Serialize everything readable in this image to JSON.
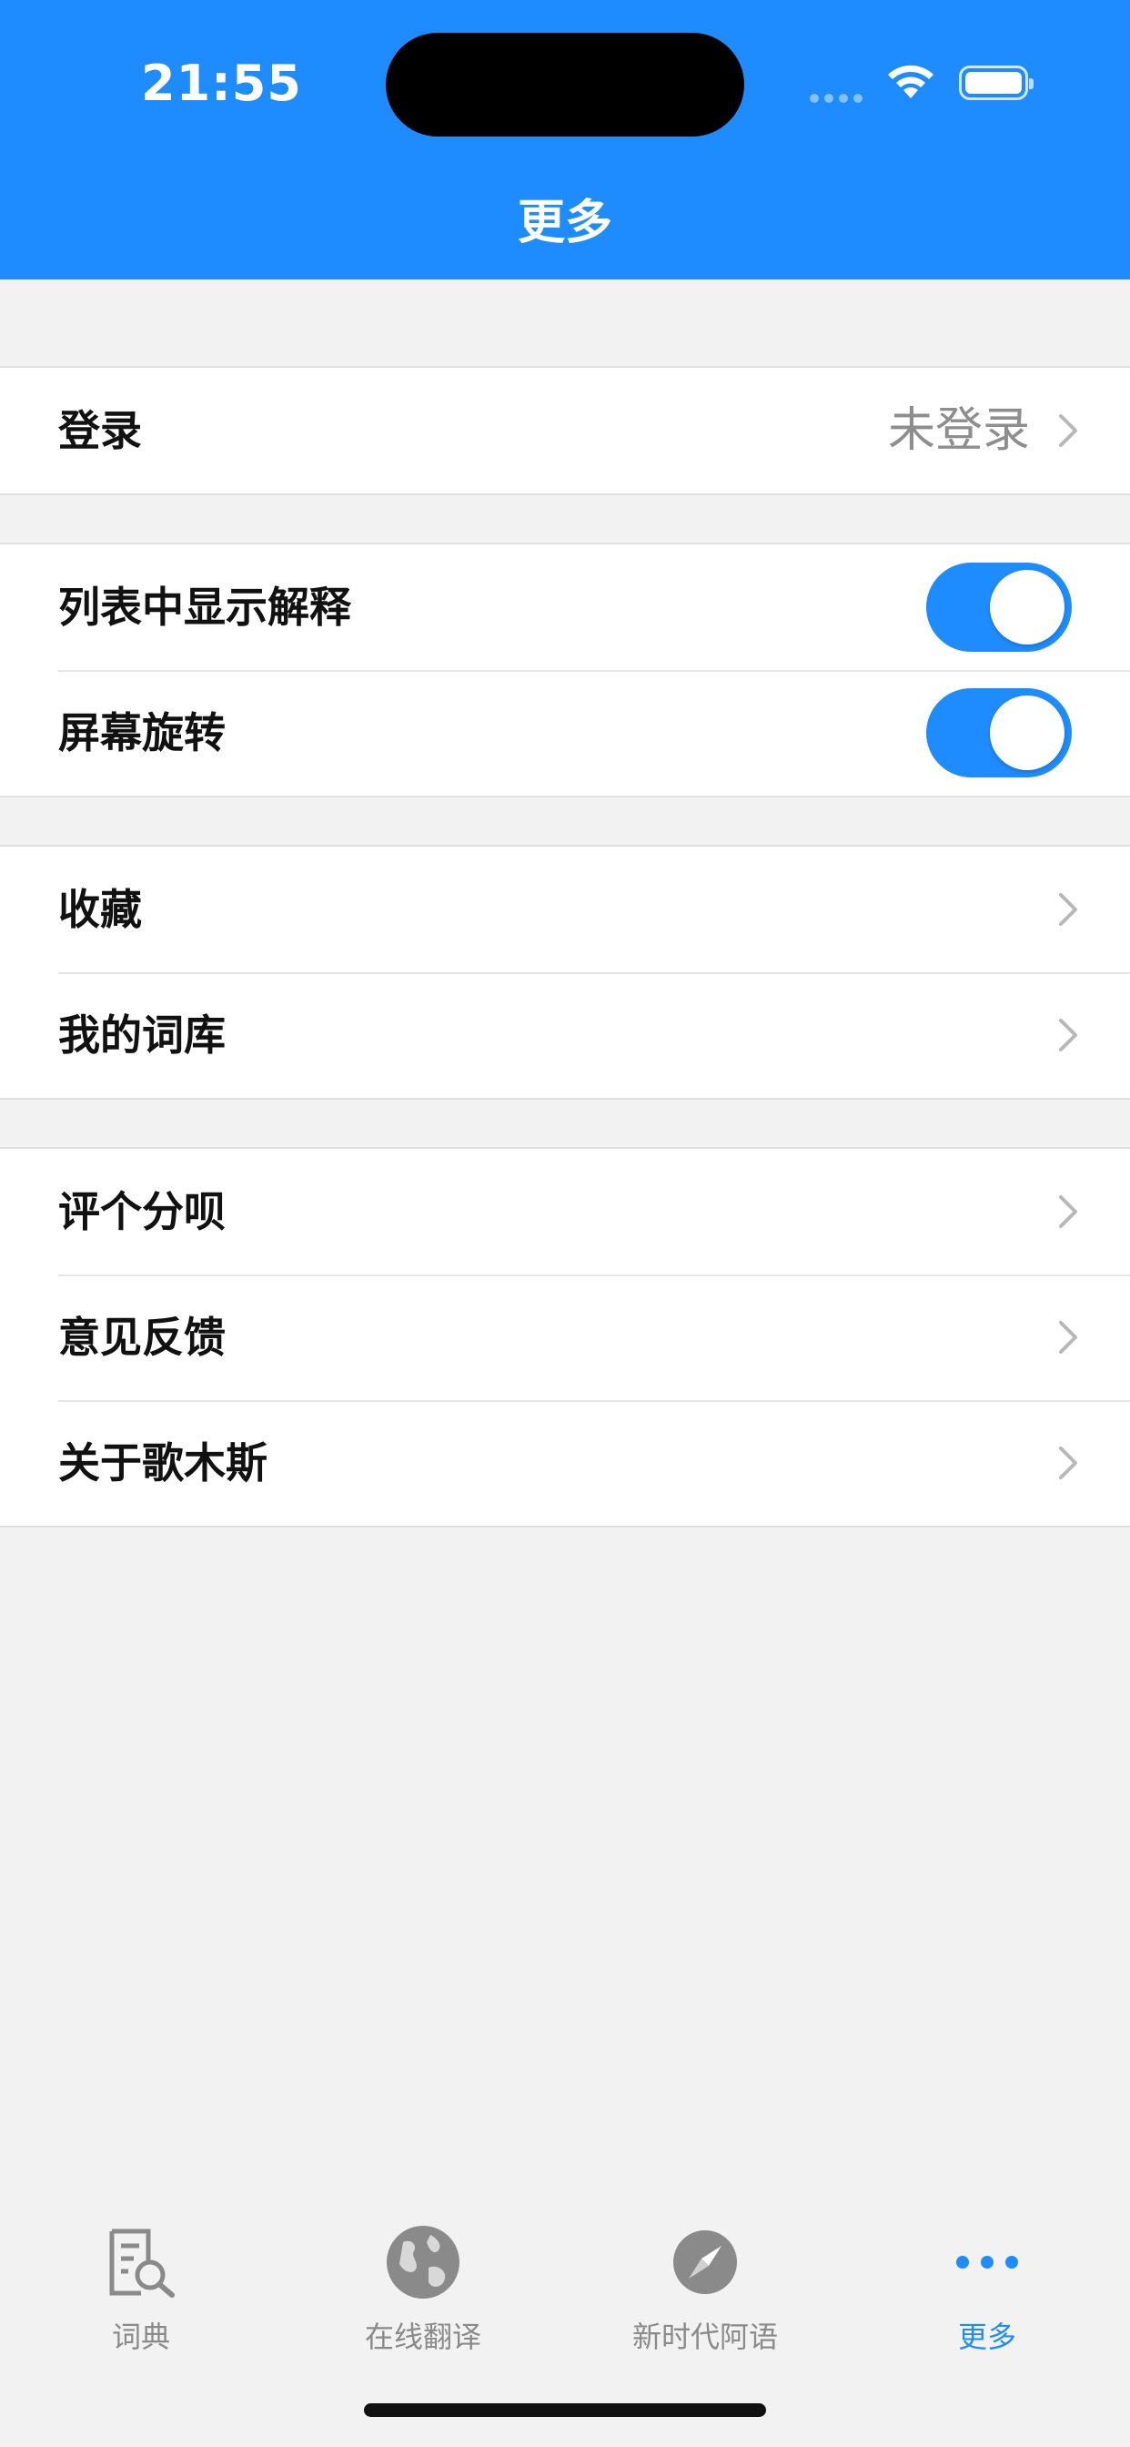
{
  "status_bar": {
    "time": "21:55"
  },
  "nav": {
    "title": "更多"
  },
  "groups": [
    {
      "rows": [
        {
          "label": "登录",
          "value": "未登录"
        }
      ]
    },
    {
      "rows": [
        {
          "label": "列表中显示解释",
          "toggle": true
        },
        {
          "label": "屏幕旋转",
          "toggle": true
        }
      ]
    },
    {
      "rows": [
        {
          "label": "收藏"
        },
        {
          "label": "我的词库"
        }
      ]
    },
    {
      "rows": [
        {
          "label": "评个分呗"
        },
        {
          "label": "意见反馈"
        },
        {
          "label": "关于歌木斯"
        }
      ]
    }
  ],
  "tabs": [
    {
      "label": "词典",
      "icon": "dictionary-search-icon"
    },
    {
      "label": "在线翻译",
      "icon": "globe-icon"
    },
    {
      "label": "新时代阿语",
      "icon": "compass-icon"
    },
    {
      "label": "更多",
      "icon": "more-dots-icon",
      "active": true
    }
  ],
  "colors": {
    "accent": "#1e8cff",
    "background": "#f2f2f2",
    "inactive_tab": "#8a8a8a"
  }
}
